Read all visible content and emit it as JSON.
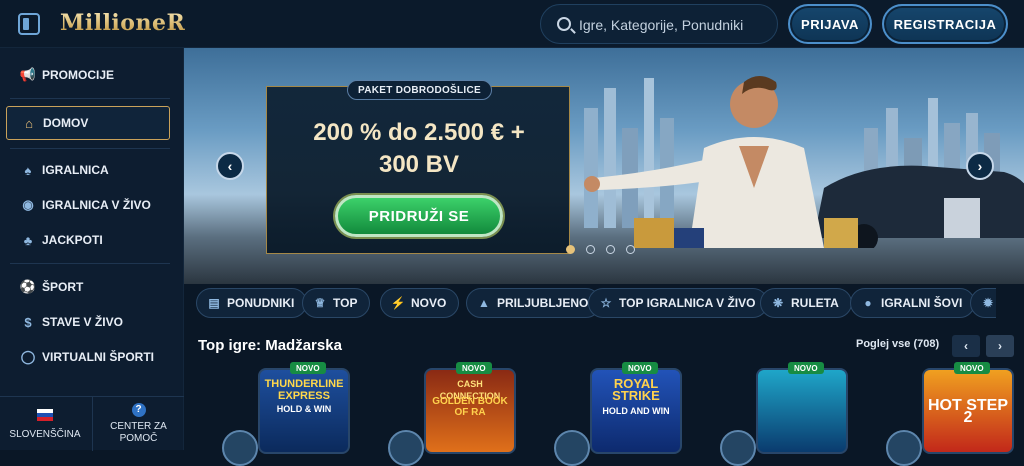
{
  "header": {
    "logo": "MillioneR",
    "search_placeholder": "Igre, Kategorije, Ponudniki",
    "login_label": "PRIJAVA",
    "register_label": "REGISTRACIJA"
  },
  "sidebar": {
    "items": [
      {
        "label": "PROMOCIJE",
        "icon": "megaphone-icon"
      },
      {
        "label": "DOMOV",
        "icon": "home-icon",
        "active": true
      },
      {
        "label": "IGRALNICA",
        "icon": "spade-icon"
      },
      {
        "label": "IGRALNICA V ŽIVO",
        "icon": "chip-icon"
      },
      {
        "label": "JACKPOTI",
        "icon": "clover-icon"
      },
      {
        "label": "ŠPORT",
        "icon": "football-icon"
      },
      {
        "label": "STAVE V ŽIVO",
        "icon": "live-bet-icon"
      },
      {
        "label": "VIRTUALNI ŠPORTI",
        "icon": "virtual-sport-icon"
      }
    ],
    "footer": {
      "language": "SLOVENŠČINA",
      "help_line1": "CENTER ZA",
      "help_line2": "POMOČ",
      "help_icon": "?"
    }
  },
  "banner": {
    "badge": "PAKET DOBRODOŠLICE",
    "title_line1": "200 % do 2.500 € +",
    "title_line2": "300 BV",
    "cta": "PRIDRUŽI SE",
    "slides": 4,
    "active_slide": 1
  },
  "chips": [
    {
      "label": "PONUDNIKI",
      "icon": "book-icon"
    },
    {
      "label": "TOP",
      "icon": "crown-icon"
    },
    {
      "label": "NOVO",
      "icon": "bolt-icon"
    },
    {
      "label": "PRILJUBLJENO",
      "icon": "flame-icon"
    },
    {
      "label": "TOP IGRALNICA V ŽIVO",
      "icon": "star-icon"
    },
    {
      "label": "RULETA",
      "icon": "roulette-icon"
    },
    {
      "label": "IGRALNI ŠOVI",
      "icon": "mic-icon"
    }
  ],
  "top_games": {
    "title": "Top igre: Madžarska",
    "view_all": "Poglej vse (708)",
    "prev": "‹",
    "next": "›",
    "cards": [
      {
        "badge": "NOVO",
        "title": "THUNDERLINE EXPRESS",
        "subtitle": "HOLD & WIN",
        "color_top": "#1e4f9e",
        "color_bottom": "#0b2a5c",
        "title_color": "#ffd84a"
      },
      {
        "badge": "NOVO",
        "title": "CASH CONNECTION",
        "subtitle": "GOLDEN BOOK OF RA",
        "color_top": "#8a2a14",
        "color_bottom": "#e0701a",
        "title_color": "#ffe07a"
      },
      {
        "badge": "NOVO",
        "title": "ROYAL STRIKE",
        "subtitle": "HOLD AND WIN",
        "color_top": "#2253b8",
        "color_bottom": "#0d2a6e",
        "title_color": "#ffd24d"
      },
      {
        "badge": "NOVO",
        "title": "",
        "subtitle": "",
        "color_top": "#1fa6c9",
        "color_bottom": "#0a3b6e",
        "title_color": "#ffffff"
      },
      {
        "badge": "NOVO",
        "title": "HOT STEP 2",
        "subtitle": "",
        "color_top": "#f0a020",
        "color_bottom": "#c2281a",
        "title_color": "#ffffff"
      }
    ]
  }
}
